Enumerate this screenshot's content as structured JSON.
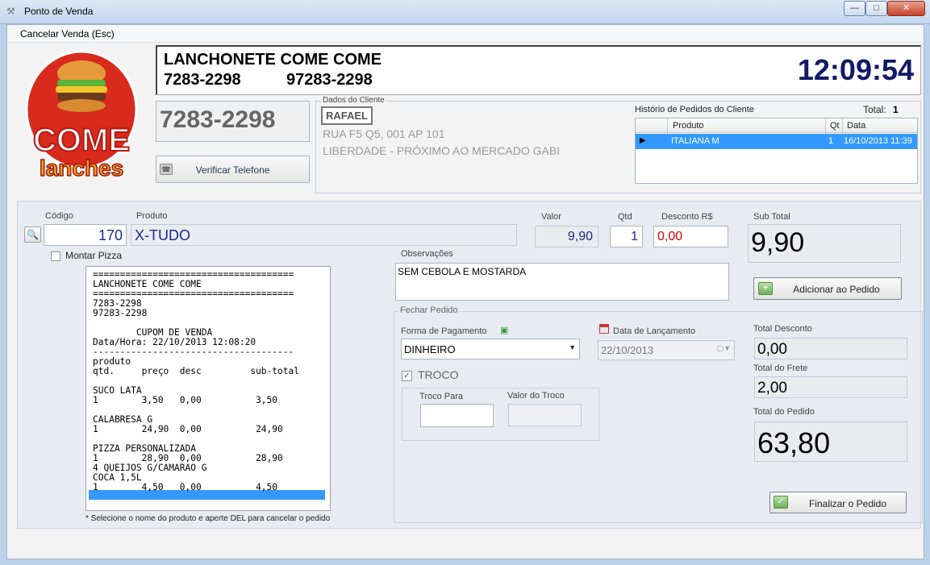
{
  "window": {
    "title": "Ponto de Venda",
    "minimize": "—",
    "maximize": "□",
    "close": "✕"
  },
  "menu": {
    "cancel": "Cancelar Venda (Esc)"
  },
  "logo": {
    "line1": "COME",
    "line2": "lanches"
  },
  "store": {
    "name": "LANCHONETE COME COME",
    "phone1": "7283-2298",
    "phone2": "97283-2298",
    "clock": "12:09:54"
  },
  "lookup": {
    "phone": "7283-2298",
    "verify_label": "Verificar Telefone"
  },
  "client": {
    "legend": "Dados do Cliente",
    "name": "RAFAEL",
    "address1": "RUA F5 Q5, 001 AP 101",
    "address2": "LIBERDADE - PRÓXIMO AO MERCADO GABI"
  },
  "history": {
    "label": "Histório de Pedidos do Cliente",
    "total_label": "Total:",
    "total": "1",
    "columns": {
      "product": "Produto",
      "qty": "Qt",
      "date": "Data"
    },
    "rows": [
      {
        "product": "ITALIANA M",
        "qty": "1",
        "date": "16/10/2013 11:39"
      }
    ]
  },
  "item": {
    "code_label": "Código",
    "code": "170",
    "product_label": "Produto",
    "product": "X-TUDO",
    "value_label": "Valor",
    "value": "9,90",
    "qty_label": "Qtd",
    "qty": "1",
    "discount_label": "Desconto R$",
    "discount": "0,00",
    "subtotal_label": "Sub Total",
    "subtotal": "9,90",
    "montar_label": "Montar Pizza"
  },
  "receipt": {
    "lines": [
      "=====================================",
      "LANCHONETE COME COME",
      "=====================================",
      "7283-2298",
      "97283-2298",
      "",
      "        CUPOM DE VENDA",
      "Data/Hora: 22/10/2013 12:08:20",
      "-------------------------------------",
      "produto",
      "qtd.     preço  desc         sub-total",
      "",
      "SUCO LATA",
      "1        3,50   0,00          3,50",
      "",
      "CALABRESA G",
      "1        24,90  0,00          24,90",
      "",
      "PIZZA PERSONALIZADA",
      "1        28,90  0,00          28,90",
      "4 QUEIJOS G/CAMARAO G",
      "COCA 1,5L",
      "1        4,50   0,00          4,50"
    ],
    "hint": "* Selecione o nome do produto e aperte DEL para cancelar o pedido"
  },
  "obs": {
    "label": "Observações",
    "text": "SEM CEBOLA E MOSTARDA"
  },
  "add_button": "Adicionar ao Pedido",
  "close_order": {
    "legend": "Fechar Pedido",
    "payment_label": "Forma de Pagamento",
    "payment": "DINHEIRO",
    "date_label": "Data de Lançamento",
    "date": "22/10/2013",
    "troco_label": "TROCO",
    "troco_para_label": "Troco Para",
    "troco_valor_label": "Valor do Troco",
    "total_discount_label": "Total Desconto",
    "total_discount": "0,00",
    "total_freight_label": "Total do Frete",
    "total_freight": "2,00",
    "total_order_label": "Total do Pedido",
    "total_order": "63,80",
    "finish_button": "Finalizar o Pedido"
  },
  "colors": {
    "accent": "#3399ff",
    "clock": "#111a66",
    "discount": "#dd0000",
    "values": "#1a2a8a"
  }
}
